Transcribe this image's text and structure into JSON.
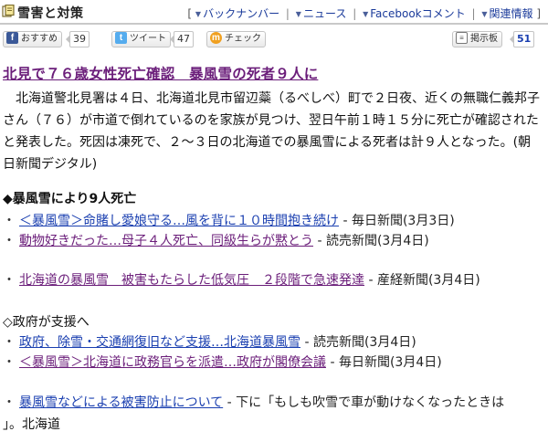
{
  "header": {
    "title": "雪害と対策",
    "nav": [
      {
        "label": "バックナンバー"
      },
      {
        "label": "ニュース"
      },
      {
        "label": "Facebookコメント"
      },
      {
        "label": "関連情報"
      }
    ],
    "open_bracket": "[",
    "close_bracket": "]",
    "separator": "|",
    "arrow": "▼"
  },
  "social": {
    "recommend_label": "おすすめ",
    "recommend_count": "39",
    "tweet_label": "ツイート",
    "tweet_count": "47",
    "check_label": "チェック",
    "board_label": "掲示板",
    "board_count": "51"
  },
  "article": {
    "headline": "北見で７６歳女性死亡確認　暴風雪の死者９人に",
    "body": "北海道警北見署は４日、北海道北見市留辺蘂（るべしべ）町で２日夜、近くの無職仁義邦子さん（７６）が市道で倒れているのを家族が見つけ、翌日午前１時１５分に死亡が確認されたと発表した。死因は凍死で、２～３日の北海道での暴風雪による死者は計９人となった。(朝日新聞デジタル)"
  },
  "sections": [
    {
      "heading": "◆暴風雪により9人死亡",
      "items": [
        {
          "bullet": "・",
          "link": "＜暴風雪＞命賭し愛娘守る…風を背に１０時間抱き続け",
          "source": " - 毎日新聞(3月3日)",
          "visited": false
        },
        {
          "bullet": "・",
          "link": "動物好きだった…母子４人死亡、同級生らが黙とう",
          "source": " - 読売新聞(3月4日)",
          "visited": true
        },
        {
          "bullet": "・",
          "link": "北海道の暴風雪　被害もたらした低気圧　２段階で急速発達",
          "source": " - 産経新聞(3月4日)",
          "visited": true
        }
      ]
    },
    {
      "heading": "◇政府が支援へ",
      "items": [
        {
          "bullet": "・",
          "link": "政府、除雪・交通網復旧など支援…北海道暴風雪",
          "source": " - 読売新聞(3月4日)",
          "visited": false
        },
        {
          "bullet": "・",
          "link": "＜暴風雪＞北海道に政務官らを派遣…政府が閣僚会議",
          "source": " - 毎日新聞(3月4日)",
          "visited": true
        },
        {
          "bullet": "・",
          "link": "暴風雪などによる被害防止について",
          "source": " - 下に「もしも吹雪で車が動けなくなったときは",
          "visited": false,
          "cont": "」。北海道"
        }
      ]
    }
  ],
  "colors": {
    "link": "#1a3fb0",
    "visited": "#6b1e7a",
    "facebook": "#3b5998",
    "twitter": "#55acee",
    "check": "#f0a020"
  }
}
